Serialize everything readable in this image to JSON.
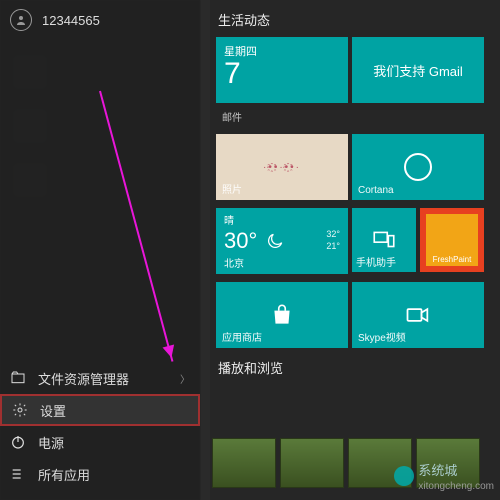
{
  "user": {
    "name": "12344565"
  },
  "sidebar": {
    "file_explorer": "文件资源管理器",
    "settings": "设置",
    "power": "电源",
    "all_apps": "所有应用"
  },
  "sections": {
    "life": "生活动态",
    "play": "播放和浏览"
  },
  "tiles": {
    "calendar": {
      "dow": "星期四",
      "day": "7",
      "caption": "邮件"
    },
    "gmail": {
      "text": "我们支持 Gmail"
    },
    "photos": {
      "caption": "照片"
    },
    "cortana": {
      "caption": "Cortana"
    },
    "weather": {
      "cond": "晴",
      "temp": "30°",
      "hi": "32°",
      "lo": "21°",
      "city": "北京"
    },
    "phone": {
      "caption": "手机助手"
    },
    "freshpaint": {
      "caption": "FreshPaint"
    },
    "store": {
      "caption": "应用商店"
    },
    "skype": {
      "caption": "Skype视频"
    }
  },
  "watermark": {
    "text": "系统城",
    "sub": "xitongcheng.com"
  }
}
